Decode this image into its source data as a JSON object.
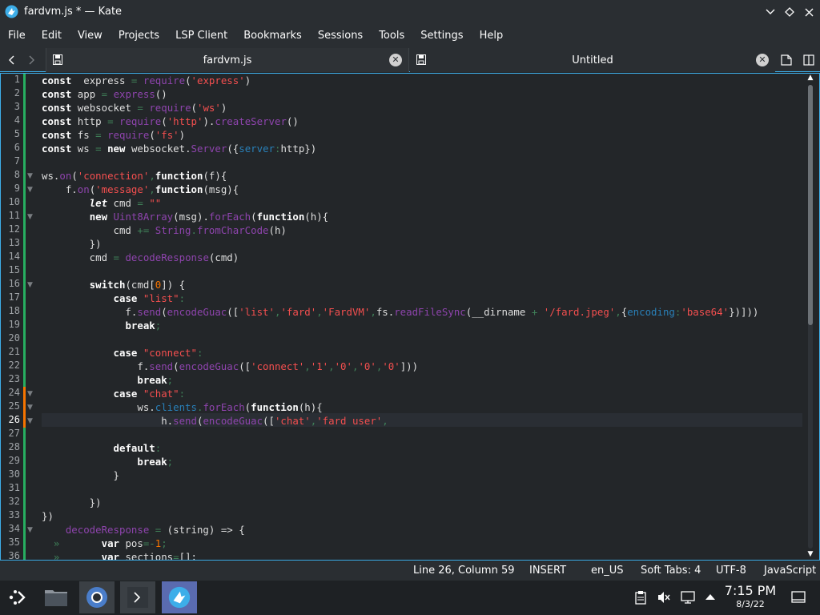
{
  "window": {
    "title": "fardvm.js * — Kate"
  },
  "menu": [
    "File",
    "Edit",
    "View",
    "Projects",
    "LSP Client",
    "Bookmarks",
    "Sessions",
    "Tools",
    "Settings",
    "Help"
  ],
  "tabs": [
    {
      "label": "fardvm.js",
      "active": true
    },
    {
      "label": "Untitled",
      "active": false
    }
  ],
  "editor": {
    "line_numbers": [
      "1",
      "2",
      "3",
      "4",
      "5",
      "6",
      "7",
      "8",
      "9",
      "10",
      "11",
      "12",
      "13",
      "14",
      "15",
      "16",
      "17",
      "18",
      "19",
      "20",
      "21",
      "22",
      "23",
      "24",
      "25",
      "26",
      "27",
      "28",
      "29",
      "30",
      "31",
      "32",
      "33",
      "34",
      "35",
      "36"
    ],
    "current_line": 26,
    "lines": [
      [
        [
          "kw",
          "const"
        ],
        [
          "",
          "  express "
        ],
        [
          "op",
          "="
        ],
        [
          "",
          " "
        ],
        [
          "fn",
          "require"
        ],
        [
          "",
          "("
        ],
        [
          "str",
          "'express'"
        ],
        [
          "",
          ")"
        ]
      ],
      [
        [
          "kw",
          "const"
        ],
        [
          "",
          " app "
        ],
        [
          "op",
          "="
        ],
        [
          "",
          " "
        ],
        [
          "fn",
          "express"
        ],
        [
          "",
          "()"
        ]
      ],
      [
        [
          "kw",
          "const"
        ],
        [
          "",
          " websocket "
        ],
        [
          "op",
          "="
        ],
        [
          "",
          " "
        ],
        [
          "fn",
          "require"
        ],
        [
          "",
          "("
        ],
        [
          "str",
          "'ws'"
        ],
        [
          "",
          ")"
        ]
      ],
      [
        [
          "kw",
          "const"
        ],
        [
          "",
          " http "
        ],
        [
          "op",
          "="
        ],
        [
          "",
          " "
        ],
        [
          "fn",
          "require"
        ],
        [
          "",
          "("
        ],
        [
          "str",
          "'http'"
        ],
        [
          "",
          ")."
        ],
        [
          "fn",
          "createServer"
        ],
        [
          "",
          "()"
        ]
      ],
      [
        [
          "kw",
          "const"
        ],
        [
          "",
          " fs "
        ],
        [
          "op",
          "="
        ],
        [
          "",
          " "
        ],
        [
          "fn",
          "require"
        ],
        [
          "",
          "("
        ],
        [
          "str",
          "'fs'"
        ],
        [
          "",
          ")"
        ]
      ],
      [
        [
          "kw",
          "const"
        ],
        [
          "",
          " ws "
        ],
        [
          "op",
          "="
        ],
        [
          "",
          " "
        ],
        [
          "kw",
          "new"
        ],
        [
          "",
          " websocket."
        ],
        [
          "fn",
          "Server"
        ],
        [
          "",
          "({"
        ],
        [
          "prop",
          "server"
        ],
        [
          "op",
          ":"
        ],
        [
          "",
          "http})"
        ]
      ],
      [],
      [
        [
          "",
          "ws."
        ],
        [
          "fn",
          "on"
        ],
        [
          "",
          "("
        ],
        [
          "str",
          "'connection'"
        ],
        [
          "op",
          ","
        ],
        [
          "kw",
          "function"
        ],
        [
          "",
          "(f){"
        ]
      ],
      [
        [
          "",
          "    f."
        ],
        [
          "fn",
          "on"
        ],
        [
          "",
          "("
        ],
        [
          "str",
          "'message'"
        ],
        [
          "op",
          ","
        ],
        [
          "kw",
          "function"
        ],
        [
          "",
          "(msg){"
        ]
      ],
      [
        [
          "",
          "        "
        ],
        [
          "kw ital",
          "let"
        ],
        [
          "",
          " cmd "
        ],
        [
          "op",
          "="
        ],
        [
          "",
          " "
        ],
        [
          "str",
          "\"\""
        ]
      ],
      [
        [
          "",
          "        "
        ],
        [
          "kw",
          "new"
        ],
        [
          "",
          " "
        ],
        [
          "fn",
          "Uint8Array"
        ],
        [
          "",
          "(msg)."
        ],
        [
          "fn",
          "forEach"
        ],
        [
          "",
          "("
        ],
        [
          "kw",
          "function"
        ],
        [
          "",
          "(h){"
        ]
      ],
      [
        [
          "",
          "            cmd "
        ],
        [
          "op",
          "+="
        ],
        [
          "",
          " "
        ],
        [
          "fn",
          "String"
        ],
        [
          "op",
          "."
        ],
        [
          "fn",
          "fromCharCode"
        ],
        [
          "",
          "(h)"
        ]
      ],
      [
        [
          "",
          "        })"
        ]
      ],
      [
        [
          "",
          "        cmd "
        ],
        [
          "op",
          "="
        ],
        [
          "",
          " "
        ],
        [
          "fn",
          "decodeResponse"
        ],
        [
          "",
          "(cmd)"
        ]
      ],
      [],
      [
        [
          "",
          "        "
        ],
        [
          "kw",
          "switch"
        ],
        [
          "",
          "(cmd["
        ],
        [
          "num",
          "0"
        ],
        [
          "",
          "]) {"
        ]
      ],
      [
        [
          "",
          "            "
        ],
        [
          "kw",
          "case"
        ],
        [
          "",
          " "
        ],
        [
          "str",
          "\"list\""
        ],
        [
          "op",
          ":"
        ]
      ],
      [
        [
          "",
          "              f."
        ],
        [
          "fn",
          "send"
        ],
        [
          "",
          "("
        ],
        [
          "fn",
          "encodeGuac"
        ],
        [
          "",
          "(["
        ],
        [
          "str",
          "'list'"
        ],
        [
          "op",
          ","
        ],
        [
          "str",
          "'fard'"
        ],
        [
          "op",
          ","
        ],
        [
          "str",
          "'FardVM'"
        ],
        [
          "op",
          ","
        ],
        [
          "",
          "fs."
        ],
        [
          "fn",
          "readFileSync"
        ],
        [
          "",
          "(__dirname "
        ],
        [
          "op",
          "+"
        ],
        [
          "",
          " "
        ],
        [
          "str",
          "'/fard.jpeg'"
        ],
        [
          "op",
          ","
        ],
        [
          "",
          "{"
        ],
        [
          "prop",
          "encoding"
        ],
        [
          "op",
          ":"
        ],
        [
          "str",
          "'base64'"
        ],
        [
          "",
          "})]))"
        ]
      ],
      [
        [
          "",
          "              "
        ],
        [
          "kw",
          "break"
        ],
        [
          "op",
          ";"
        ]
      ],
      [],
      [
        [
          "",
          "            "
        ],
        [
          "kw",
          "case"
        ],
        [
          "",
          " "
        ],
        [
          "str",
          "\"connect\""
        ],
        [
          "op",
          ":"
        ]
      ],
      [
        [
          "",
          "                f."
        ],
        [
          "fn",
          "send"
        ],
        [
          "",
          "("
        ],
        [
          "fn",
          "encodeGuac"
        ],
        [
          "",
          "(["
        ],
        [
          "str",
          "'connect'"
        ],
        [
          "op",
          ","
        ],
        [
          "str",
          "'1'"
        ],
        [
          "op",
          ","
        ],
        [
          "str",
          "'0'"
        ],
        [
          "op",
          ","
        ],
        [
          "str",
          "'0'"
        ],
        [
          "op",
          ","
        ],
        [
          "str",
          "'0'"
        ],
        [
          "",
          "]))"
        ]
      ],
      [
        [
          "",
          "                "
        ],
        [
          "kw",
          "break"
        ],
        [
          "op",
          ";"
        ]
      ],
      [
        [
          "",
          "            "
        ],
        [
          "kw",
          "case"
        ],
        [
          "",
          " "
        ],
        [
          "str",
          "\"chat\""
        ],
        [
          "op",
          ":"
        ]
      ],
      [
        [
          "",
          "                ws."
        ],
        [
          "prop",
          "clients"
        ],
        [
          "op",
          "."
        ],
        [
          "fn",
          "forEach"
        ],
        [
          "",
          "("
        ],
        [
          "kw",
          "function"
        ],
        [
          "",
          "(h){"
        ]
      ],
      [
        [
          "",
          "                    h."
        ],
        [
          "fn",
          "send"
        ],
        [
          "",
          "("
        ],
        [
          "fn",
          "encodeGuac"
        ],
        [
          "",
          "(["
        ],
        [
          "str",
          "'chat'"
        ],
        [
          "op",
          ","
        ],
        [
          "str",
          "'fard user'"
        ],
        [
          "op",
          ","
        ]
      ],
      [],
      [
        [
          "",
          "            "
        ],
        [
          "kw",
          "default"
        ],
        [
          "op",
          ":"
        ]
      ],
      [
        [
          "",
          "                "
        ],
        [
          "kw",
          "break"
        ],
        [
          "op",
          ";"
        ]
      ],
      [
        [
          "",
          "            }"
        ]
      ],
      [],
      [
        [
          "",
          "        })"
        ]
      ],
      [
        [
          "",
          "})"
        ]
      ],
      [
        [
          "",
          "    "
        ],
        [
          "fn",
          "decodeResponse"
        ],
        [
          "",
          " "
        ],
        [
          "op",
          "="
        ],
        [
          "",
          " (string) => {"
        ]
      ],
      [
        [
          "op",
          "  »   "
        ],
        [
          "",
          "    "
        ],
        [
          "kw",
          "var"
        ],
        [
          "",
          " pos"
        ],
        [
          "op",
          "=-"
        ],
        [
          "num",
          "1"
        ],
        [
          "op",
          ";"
        ]
      ],
      [
        [
          "op",
          "  »   "
        ],
        [
          "",
          "    "
        ],
        [
          "kw",
          "var"
        ],
        [
          "",
          " sections"
        ],
        [
          "op",
          "="
        ],
        [
          "",
          "[];"
        ]
      ]
    ]
  },
  "status": {
    "position": "Line 26, Column 59",
    "mode": "INSERT",
    "language_dict": "en_US",
    "indent": "Soft Tabs: 4",
    "encoding": "UTF-8",
    "syntax": "JavaScript"
  },
  "clock": {
    "time": "7:15 PM",
    "date": "8/3/22"
  }
}
